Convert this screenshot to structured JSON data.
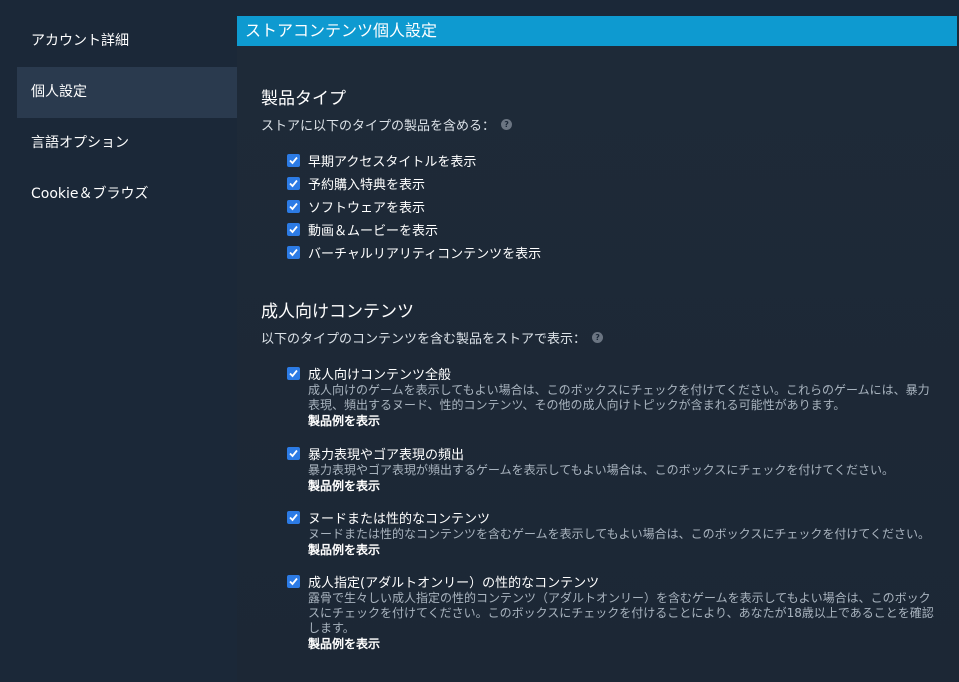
{
  "sidebar": {
    "items": [
      {
        "label": "アカウント詳細"
      },
      {
        "label": "個人設定"
      },
      {
        "label": "言語オプション"
      },
      {
        "label": "Cookie＆ブラウズ"
      }
    ]
  },
  "main": {
    "header": "ストアコンテンツ個人設定",
    "product_types": {
      "heading": "製品タイプ",
      "subtext": "ストアに以下のタイプの製品を含める：",
      "options": [
        {
          "label": "早期アクセスタイトルを表示",
          "checked": true
        },
        {
          "label": "予約購入特典を表示",
          "checked": true
        },
        {
          "label": "ソフトウェアを表示",
          "checked": true
        },
        {
          "label": "動画＆ムービーを表示",
          "checked": true
        },
        {
          "label": "バーチャルリアリティコンテンツを表示",
          "checked": true
        }
      ]
    },
    "adult": {
      "heading": "成人向けコンテンツ",
      "subtext": "以下のタイプのコンテンツを含む製品をストアで表示：",
      "options": [
        {
          "title": "成人向けコンテンツ全般",
          "desc": "成人向けのゲームを表示してもよい場合は、このボックスにチェックを付けてください。これらのゲームには、暴力表現、頻出するヌード、性的コンテンツ、その他の成人向けトピックが含まれる可能性があります。",
          "example": "製品例を表示",
          "checked": true
        },
        {
          "title": "暴力表現やゴア表現の頻出",
          "desc": "暴力表現やゴア表現が頻出するゲームを表示してもよい場合は、このボックスにチェックを付けてください。",
          "example": "製品例を表示",
          "checked": true
        },
        {
          "title": "ヌードまたは性的なコンテンツ",
          "desc": "ヌードまたは性的なコンテンツを含むゲームを表示してもよい場合は、このボックスにチェックを付けてください。",
          "example": "製品例を表示",
          "checked": true
        },
        {
          "title": "成人指定(アダルトオンリー）の性的なコンテンツ",
          "desc": "露骨で生々しい成人指定の性的コンテンツ（アダルトオンリー）を含むゲームを表示してもよい場合は、このボックスにチェックを付けてください。このボックスにチェックを付けることにより、あなたが18歳以上であることを確認します。",
          "example": "製品例を表示",
          "checked": true
        }
      ]
    }
  },
  "colors": {
    "accent": "#0e9ad0",
    "background": "#1b2838",
    "checkbox": "#2c7be5"
  }
}
